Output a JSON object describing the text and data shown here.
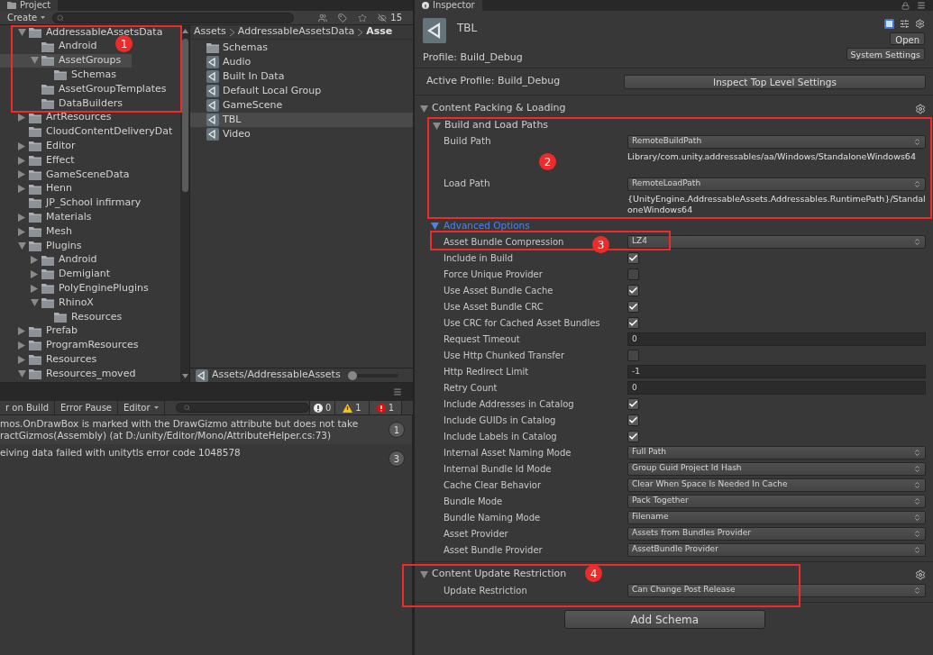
{
  "project_panel": {
    "tab": "Project",
    "create_button": "Create",
    "filter_count": "15",
    "tree": [
      {
        "name": "AddressableAssetsData",
        "expandable": true,
        "expanded": true,
        "selected": false,
        "children": [
          {
            "name": "Android",
            "expandable": false,
            "selected": false
          },
          {
            "name": "AssetGroups",
            "expandable": true,
            "expanded": true,
            "selected": true,
            "children": [
              {
                "name": "Schemas",
                "expandable": false,
                "selected": false
              }
            ]
          },
          {
            "name": "AssetGroupTemplates",
            "expandable": false,
            "selected": false
          },
          {
            "name": "DataBuilders",
            "expandable": false,
            "selected": false
          }
        ]
      },
      {
        "name": "ArtResources",
        "expandable": true,
        "expanded": false,
        "selected": false
      },
      {
        "name": "CloudContentDeliveryDat",
        "expandable": false,
        "selected": false
      },
      {
        "name": "Editor",
        "expandable": true,
        "expanded": false,
        "selected": false
      },
      {
        "name": "Effect",
        "expandable": true,
        "expanded": false,
        "selected": false
      },
      {
        "name": "GameSceneData",
        "expandable": true,
        "expanded": false,
        "selected": false
      },
      {
        "name": "Henn",
        "expandable": true,
        "expanded": false,
        "selected": false
      },
      {
        "name": "JP_School infirmary",
        "expandable": false,
        "selected": false
      },
      {
        "name": "Materials",
        "expandable": true,
        "expanded": false,
        "selected": false
      },
      {
        "name": "Mesh",
        "expandable": true,
        "expanded": false,
        "selected": false
      },
      {
        "name": "Plugins",
        "expandable": true,
        "expanded": true,
        "selected": false,
        "children": [
          {
            "name": "Android",
            "expandable": true,
            "expanded": false,
            "selected": false
          },
          {
            "name": "Demigiant",
            "expandable": true,
            "expanded": false,
            "selected": false
          },
          {
            "name": "PolyEnginePlugins",
            "expandable": true,
            "expanded": false,
            "selected": false
          },
          {
            "name": "RhinoX",
            "expandable": true,
            "expanded": true,
            "selected": false,
            "children": [
              {
                "name": "Resources",
                "expandable": false,
                "selected": false
              }
            ]
          }
        ]
      },
      {
        "name": "Prefab",
        "expandable": true,
        "expanded": false,
        "selected": false
      },
      {
        "name": "ProgramResources",
        "expandable": true,
        "expanded": false,
        "selected": false
      },
      {
        "name": "Resources",
        "expandable": true,
        "expanded": false,
        "selected": false
      },
      {
        "name": "Resources_moved",
        "expandable": true,
        "expanded": true,
        "selected": false
      }
    ],
    "breadcrumb": [
      "Assets",
      "AddressableAssetsData",
      "Asse"
    ],
    "files": [
      {
        "name": "Schemas",
        "kind": "folder",
        "selected": false
      },
      {
        "name": "Audio",
        "kind": "group",
        "selected": false
      },
      {
        "name": "Built In Data",
        "kind": "group",
        "selected": false
      },
      {
        "name": "Default Local Group",
        "kind": "group",
        "selected": false
      },
      {
        "name": "GameScene",
        "kind": "group",
        "selected": false
      },
      {
        "name": "TBL",
        "kind": "group",
        "selected": true
      },
      {
        "name": "Video",
        "kind": "group",
        "selected": false
      }
    ],
    "selected_path": "Assets/AddressableAssets",
    "size_slider": {
      "level": 0
    }
  },
  "console": {
    "buttons": [
      "r on Build",
      "Error Pause",
      "Editor"
    ],
    "info_count": "0",
    "warning_count": "1",
    "error_count": "1",
    "messages": [
      {
        "lines": [
          "mos.OnDrawBox is marked with the DrawGizmo attribute but does not take",
          "ractGizmos(Assembly) (at D:/unity/Editor/Mono/AttributeHelper.cs:73)"
        ],
        "count": "1"
      },
      {
        "lines": [
          "eiving data failed with unitytls error code 1048578"
        ],
        "count": "3"
      }
    ]
  },
  "inspector": {
    "tab": "Inspector",
    "title": "TBL",
    "open_button": "Open",
    "profile": "Profile: Build_Debug",
    "system_settings_button": "System Settings",
    "active_profile": "Active Profile: Build_Debug",
    "inspect_button": "Inspect Top Level Settings",
    "packing_section": {
      "title": "Content Packing & Loading",
      "expanded": true,
      "paths": {
        "title": "Build and Load Paths",
        "expanded": true,
        "rows": [
          {
            "label": "Build Path",
            "value": "RemoteBuildPath",
            "path": "Library/com.unity.addressables/aa/Windows/StandaloneWindows64"
          },
          {
            "label": "Load Path",
            "value": "RemoteLoadPath",
            "path": "{UnityEngine.AddressableAssets.Addressables.RuntimePath}/StandaloneWindows64"
          }
        ]
      },
      "advanced": {
        "title": "Advanced Options",
        "expanded": true,
        "rows": [
          {
            "kind": "dropdown",
            "label": "Asset Bundle Compression",
            "value": "LZ4"
          },
          {
            "kind": "checkbox",
            "label": "Include in Build",
            "checked": true
          },
          {
            "kind": "checkbox",
            "label": "Force Unique Provider",
            "checked": false
          },
          {
            "kind": "checkbox",
            "label": "Use Asset Bundle Cache",
            "checked": true
          },
          {
            "kind": "checkbox",
            "label": "Use Asset Bundle CRC",
            "checked": true
          },
          {
            "kind": "checkbox",
            "label": "Use CRC for Cached Asset Bundles",
            "checked": true
          },
          {
            "kind": "field",
            "label": "Request Timeout",
            "value": "0"
          },
          {
            "kind": "checkbox",
            "label": "Use Http Chunked Transfer",
            "checked": false
          },
          {
            "kind": "field",
            "label": "Http Redirect Limit",
            "value": "-1"
          },
          {
            "kind": "field",
            "label": "Retry Count",
            "value": "0"
          },
          {
            "kind": "checkbox",
            "label": "Include Addresses in Catalog",
            "checked": true
          },
          {
            "kind": "checkbox",
            "label": "Include GUIDs in Catalog",
            "checked": true
          },
          {
            "kind": "checkbox",
            "label": "Include Labels in Catalog",
            "checked": true
          },
          {
            "kind": "dropdown",
            "label": "Internal Asset Naming Mode",
            "value": "Full Path"
          },
          {
            "kind": "dropdown",
            "label": "Internal Bundle Id Mode",
            "value": "Group Guid Project Id Hash"
          },
          {
            "kind": "dropdown",
            "label": "Cache Clear Behavior",
            "value": "Clear When Space Is Needed In Cache"
          },
          {
            "kind": "dropdown",
            "label": "Bundle Mode",
            "value": "Pack Together"
          },
          {
            "kind": "dropdown",
            "label": "Bundle Naming Mode",
            "value": "Filename"
          },
          {
            "kind": "dropdown",
            "label": "Asset Provider",
            "value": "Assets from Bundles Provider"
          },
          {
            "kind": "dropdown",
            "label": "Asset Bundle Provider",
            "value": "AssetBundle Provider"
          }
        ]
      }
    },
    "update_section": {
      "title": "Content Update Restriction",
      "expanded": true,
      "rows": [
        {
          "kind": "dropdown",
          "label": "Update Restriction",
          "value": "Can Change Post Release"
        }
      ]
    },
    "add_schema_button": "Add Schema"
  },
  "annotations": [
    {
      "number": "1"
    },
    {
      "number": "2"
    },
    {
      "number": "3"
    },
    {
      "number": "4"
    }
  ]
}
